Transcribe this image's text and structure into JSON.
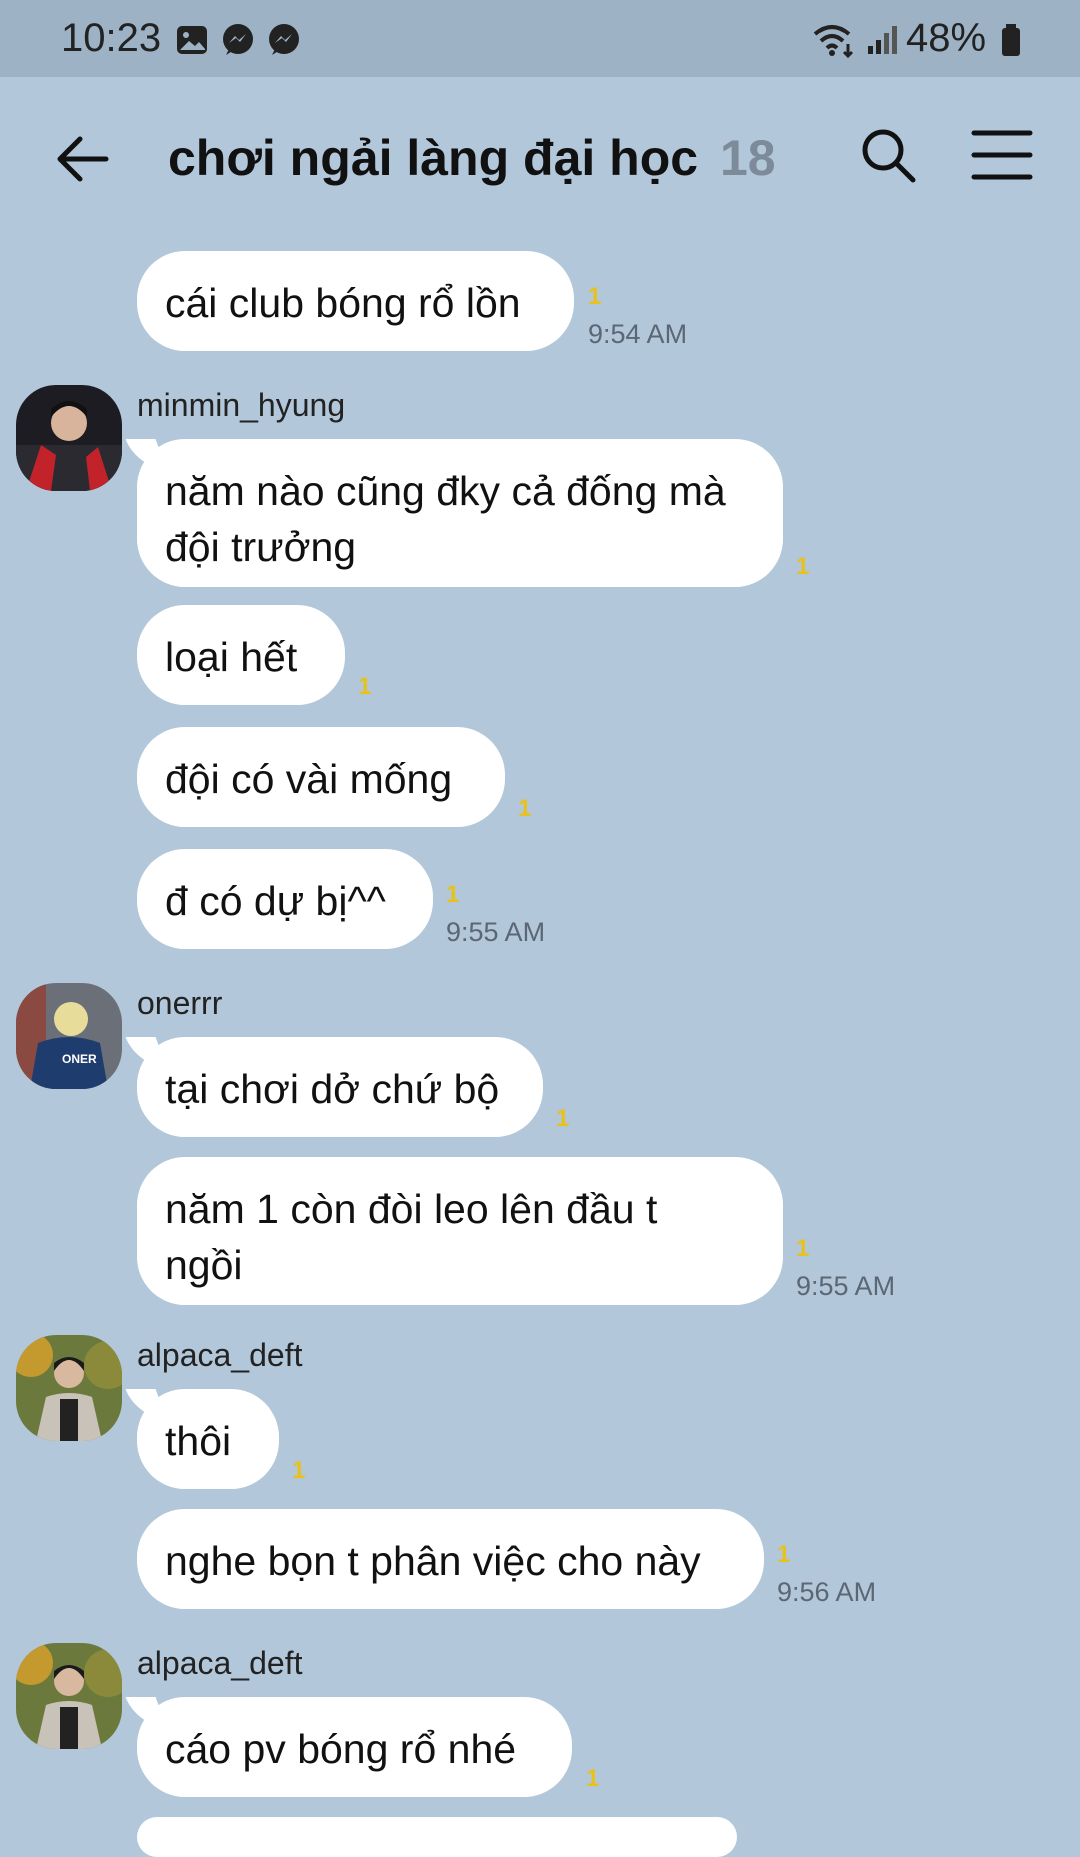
{
  "status_bar": {
    "time": "10:23",
    "battery": "48%"
  },
  "header": {
    "title": "chơi ngải làng đại học",
    "member_count": "18"
  },
  "messages": [
    {
      "text": "cái club bóng rổ lồn",
      "read": "1",
      "time": "9:54 AM"
    },
    {
      "sender": "minmin_hyung",
      "text": "năm nào cũng đky cả đống mà\nđội trưởng",
      "read": "1"
    },
    {
      "text": "loại hết",
      "read": "1"
    },
    {
      "text": "đội có vài mống",
      "read": "1"
    },
    {
      "text": "đ có dự bị^^",
      "read": "1",
      "time": "9:55 AM"
    },
    {
      "sender": "onerrr",
      "text": "tại chơi dở chứ bộ",
      "read": "1"
    },
    {
      "text": "năm 1 còn đòi leo lên đầu t\nngồi",
      "read": "1",
      "time": "9:55 AM"
    },
    {
      "sender": "alpaca_deft",
      "text": "thôi",
      "read": "1"
    },
    {
      "text": "nghe bọn t phân việc cho này",
      "read": "1",
      "time": "9:56 AM"
    },
    {
      "sender": "alpaca_deft",
      "text": "cáo pv bóng rổ nhé",
      "read": "1"
    }
  ],
  "colors": {
    "chat_background": "#b2c7da",
    "status_bar": "#9eb2c6",
    "bubble": "#ffffff",
    "read_count": "#e8c21a"
  },
  "avatars": {
    "minmin_hyung": "avatar-photo-red-jacket",
    "onerrr": "avatar-photo-blonde-oner-jacket",
    "alpaca_deft": "avatar-photo-autumn-trees"
  }
}
